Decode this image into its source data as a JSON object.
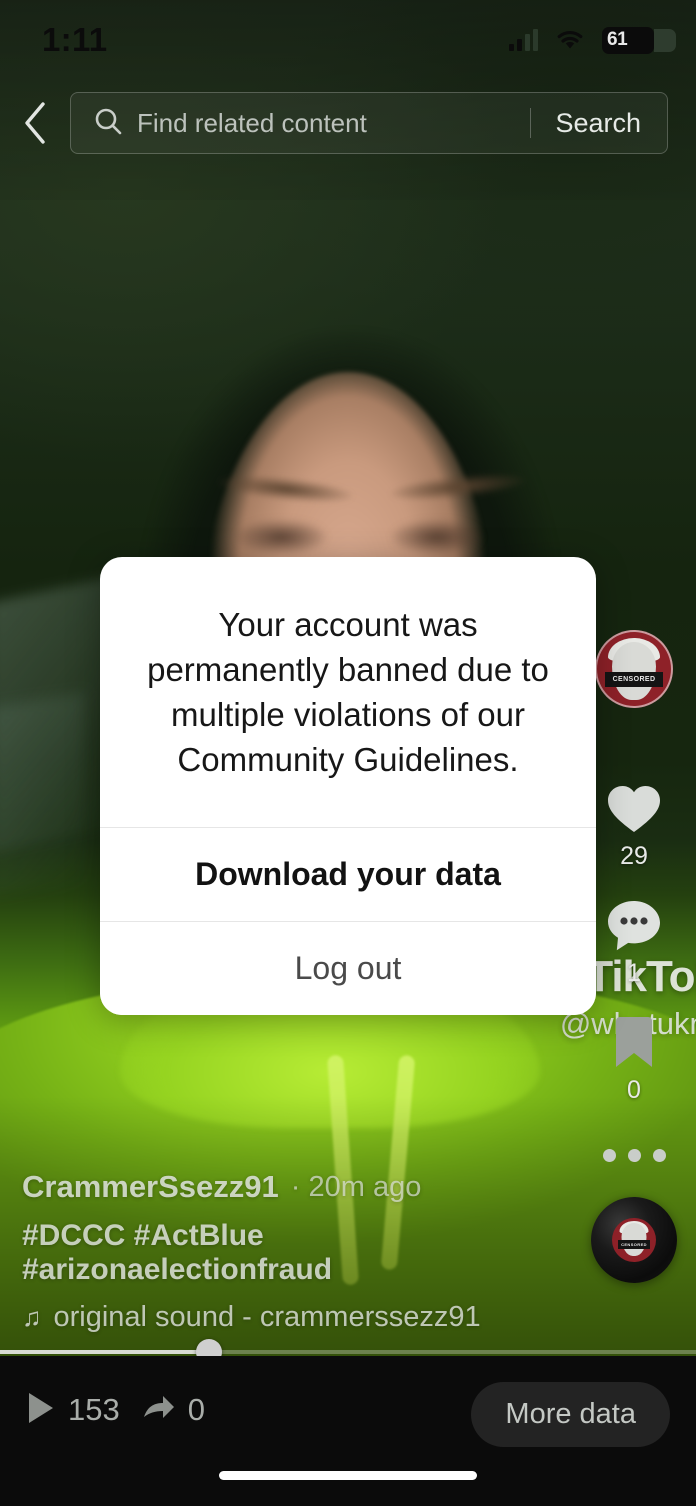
{
  "status_bar": {
    "time": "1:11",
    "battery_level": "61",
    "signal_icon": "cellular-signal-icon",
    "wifi_icon": "wifi-icon",
    "battery_icon": "battery-icon"
  },
  "header": {
    "back_icon": "back-chevron-icon",
    "search_icon": "search-icon",
    "search_value": "",
    "search_placeholder": "Find related content",
    "search_button_label": "Search"
  },
  "dialog": {
    "message": "Your account was permanently banned due to multiple violations of our Community Guidelines.",
    "primary_action": "Download your data",
    "secondary_action": "Log out"
  },
  "rail": {
    "avatar_name": "profile-avatar",
    "avatar_badge_text": "CENSORED",
    "like": {
      "icon": "heart-icon",
      "count": "29"
    },
    "comment": {
      "icon": "comment-bubble-icon",
      "count": "1"
    },
    "bookmark": {
      "icon": "bookmark-icon",
      "count": "0"
    },
    "more_icon": "more-horizontal-icon",
    "music_disc": "music-disc-icon"
  },
  "watermark": {
    "logo_icon": "tiktok-logo-icon",
    "text": "TikTok",
    "handle": "@whatukno"
  },
  "caption": {
    "username": "CrammerSsezz91",
    "timestamp": "· 20m ago",
    "hashtags": "#DCCC #ActBlue #arizonaelectionfraud",
    "music_note_icon": "music-note-icon",
    "music": "original sound - crammerssezz91"
  },
  "progress": {
    "percent": 30
  },
  "bottom_bar": {
    "play_icon": "play-icon",
    "play_count": "153",
    "share_icon": "share-arrow-icon",
    "share_count": "0",
    "more_data_label": "More data"
  },
  "colors": {
    "accent_red": "#8e2128",
    "hoodie_green": "#8ecb1e",
    "bar_black": "#0b0b0b"
  }
}
